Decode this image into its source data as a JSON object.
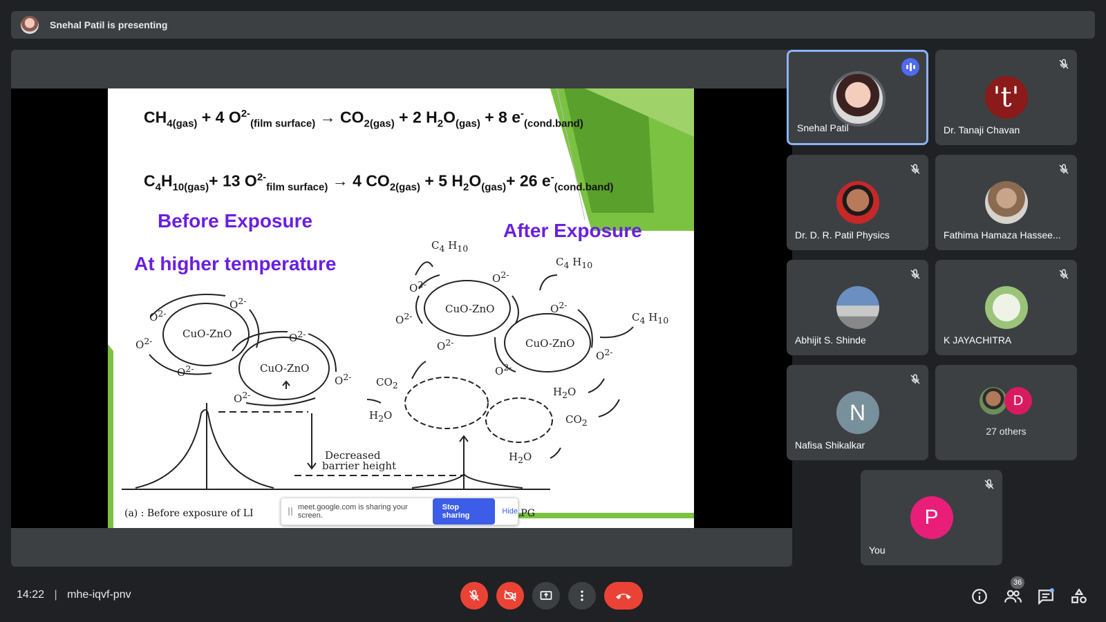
{
  "presenter_bar": {
    "text": "Snehal Patil is presenting"
  },
  "slide": {
    "eq1": {
      "a": "CH",
      "a_sub": "4(gas)",
      "b": " + 4 O",
      "b_sup": "2-",
      "b_sub": "(film surface)",
      "arrow": " → CO",
      "c_sub": "2(gas)",
      "d": " + 2 H",
      "d_sub": "2",
      "e": "O",
      "e_sub": "(gas)",
      "f": "  +  8 e",
      "f_sup": "-",
      "f_sub": "(cond.band)"
    },
    "eq2": {
      "a": "C",
      "a_sub": "4",
      "b": "H",
      "b_sub": "10(gas)",
      "c": "+ 13 O",
      "c_sup": "2-",
      "c_sub": "film surface)",
      "d": " → 4 CO",
      "d_sub": "2(gas)",
      "e": " + 5 H",
      "e_sub": "2",
      "f": "O",
      "f_sub": "(gas)",
      "g": "+ 26 e",
      "g_sup": "-",
      "g_sub": "(cond.band)"
    },
    "before_exposure": "Before Exposure",
    "after_exposure": "After Exposure",
    "higher_temp": "At higher temperature",
    "grain_label": "CuO-ZnO",
    "o2_label": "O",
    "o2_sup": "2-",
    "c4h10": "C",
    "c4h10_sub1": "4",
    "c4h10_h": " H",
    "c4h10_sub2": "10",
    "co2": "CO",
    "co2_sub": "2",
    "h2o_h": "H",
    "h2o_sub": "2",
    "h2o_o": "O",
    "decreased_1": "Decreased",
    "decreased_2": "barrier height",
    "caption_left": "(a)  : Before exposure of LI",
    "caption_right": "LPG"
  },
  "share_bar": {
    "message": "meet.google.com is sharing your screen.",
    "stop": "Stop sharing",
    "hide": "Hide"
  },
  "participants": [
    {
      "name": "Snehal Patil"
    },
    {
      "name": "Dr. Tanaji Chavan",
      "initial": "'t'"
    },
    {
      "name": "Dr. D. R. Patil Physics"
    },
    {
      "name": "Fathima Hamaza Hassee..."
    },
    {
      "name": "Abhijit S. Shinde"
    },
    {
      "name": "K JAYACHITRA"
    },
    {
      "name": "Nafisa Shikalkar",
      "initial": "N"
    },
    {
      "name": "27 others",
      "initial": "D"
    },
    {
      "name": "You",
      "initial": "P"
    }
  ],
  "bottom_bar": {
    "time": "14:22",
    "separator": "|",
    "meeting_code": "mhe-iqvf-pnv",
    "people_count": "36"
  },
  "colors": {
    "accent": "#8ab4f8",
    "end_call": "#ea4335",
    "slide_purple": "#6a1fe0",
    "slide_green": "#7cc242"
  }
}
